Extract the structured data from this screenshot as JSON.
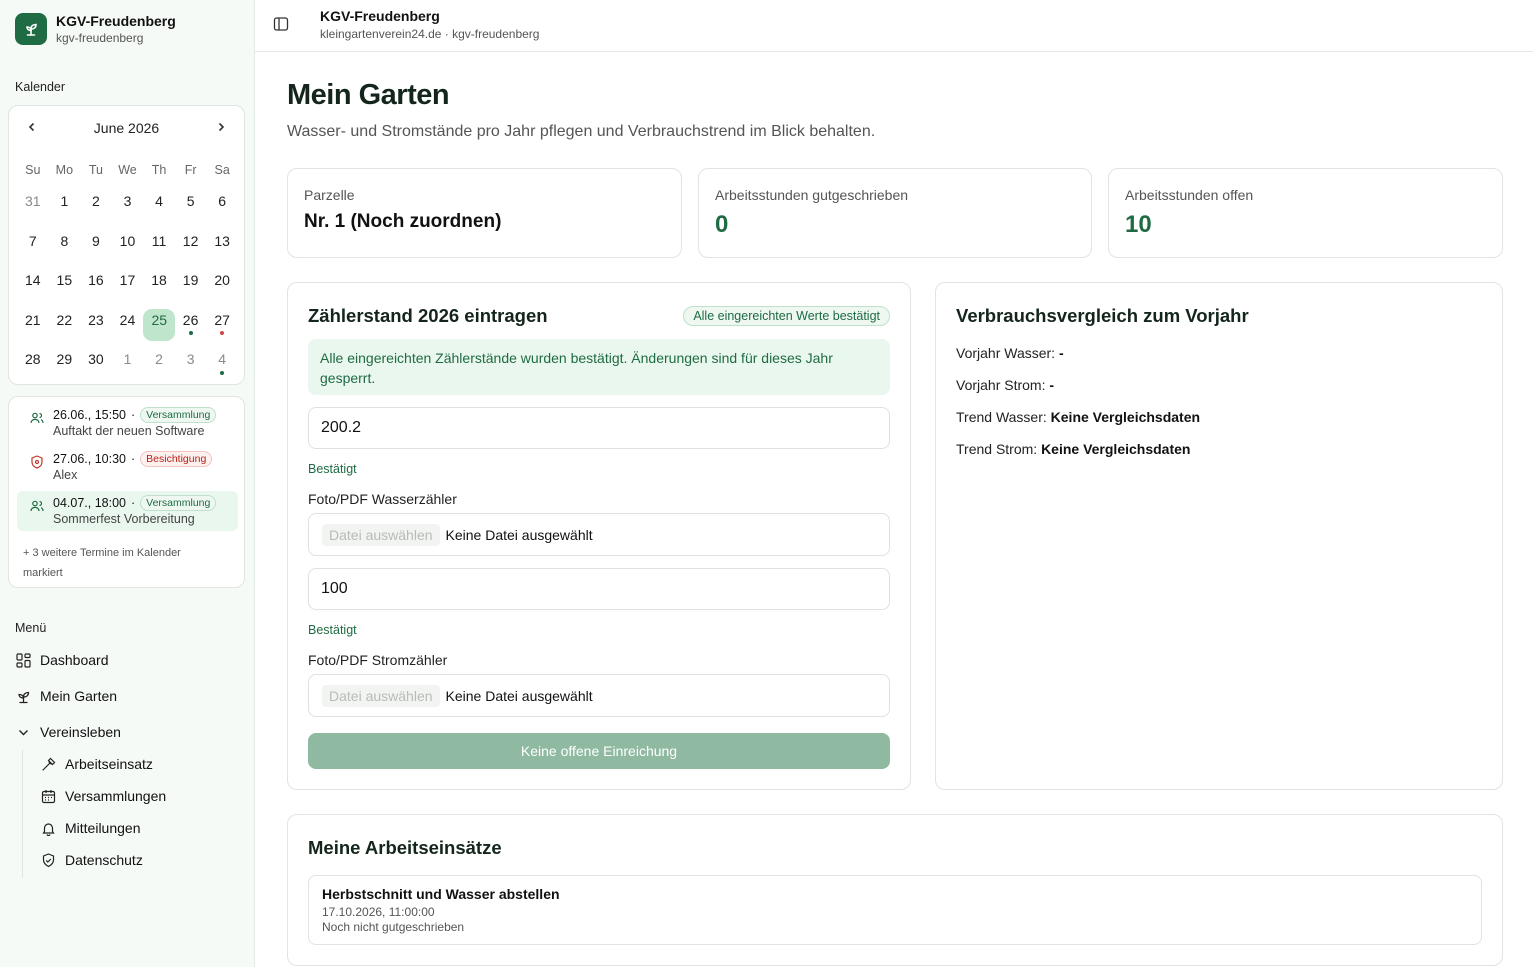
{
  "app": {
    "name": "KGV-Freudenberg",
    "slug": "kgv-freudenberg"
  },
  "topbar": {
    "title": "KGV-Freudenberg",
    "subtitle": "kleingartenverein24.de · kgv-freudenberg"
  },
  "sidebar": {
    "calendar_label": "Kalender",
    "calendar": {
      "month": "June 2026",
      "weekdays": [
        "Su",
        "Mo",
        "Tu",
        "We",
        "Th",
        "Fr",
        "Sa"
      ],
      "weeks": [
        [
          "31",
          "1",
          "2",
          "3",
          "4",
          "5",
          "6"
        ],
        [
          "7",
          "8",
          "9",
          "10",
          "11",
          "12",
          "13"
        ],
        [
          "14",
          "15",
          "16",
          "17",
          "18",
          "19",
          "20"
        ],
        [
          "21",
          "22",
          "23",
          "24",
          "25",
          "26",
          "27"
        ],
        [
          "28",
          "29",
          "30",
          "1",
          "2",
          "3",
          "4"
        ]
      ],
      "today": "25"
    },
    "events": [
      {
        "datetime": "26.06., 15:50",
        "type": "Versammlung",
        "title": "Auftakt der neuen Software"
      },
      {
        "datetime": "27.06., 10:30",
        "type": "Besichtigung",
        "title": "Alex"
      },
      {
        "datetime": "04.07., 18:00",
        "type": "Versammlung",
        "title": "Sommerfest Vorbereitung"
      }
    ],
    "more_events": "+ 3 weitere Termine im Kalender markiert",
    "menu_label": "Menü",
    "menu": {
      "dashboard": "Dashboard",
      "mein_garten": "Mein Garten",
      "vereinsleben": "Vereinsleben",
      "arbeitseinsatz": "Arbeitseinsatz",
      "versammlungen": "Versammlungen",
      "mitteilungen": "Mitteilungen",
      "datenschutz": "Datenschutz"
    }
  },
  "page": {
    "title": "Mein Garten",
    "lead": "Wasser- und Stromstände pro Jahr pflegen und Verbrauchstrend im Blick behalten."
  },
  "stats": {
    "parzelle_label": "Parzelle",
    "parzelle_value": "Nr. 1 (Noch zuordnen)",
    "credited_label": "Arbeitsstunden gutgeschrieben",
    "credited_value": "0",
    "open_label": "Arbeitsstunden offen",
    "open_value": "10"
  },
  "meter": {
    "title": "Zählerstand 2026 eintragen",
    "status_pill": "Alle eingereichten Werte bestätigt",
    "notice": "Alle eingereichten Zählerstände wurden bestätigt. Änderungen sind für dieses Jahr gesperrt.",
    "water_value": "200.2",
    "water_status": "Bestätigt",
    "water_file_label": "Foto/PDF Wasserzähler",
    "power_value": "100",
    "power_status": "Bestätigt",
    "power_file_label": "Foto/PDF Stromzähler",
    "file_button": "Datei auswählen",
    "file_none": "Keine Datei ausgewählt",
    "submit": "Keine offene Einreichung"
  },
  "comparison": {
    "title": "Verbrauchsvergleich zum Vorjahr",
    "rows": [
      {
        "label": "Vorjahr Wasser:",
        "value": "-"
      },
      {
        "label": "Vorjahr Strom:",
        "value": "-"
      },
      {
        "label": "Trend Wasser:",
        "value": "Keine Vergleichsdaten"
      },
      {
        "label": "Trend Strom:",
        "value": "Keine Vergleichsdaten"
      }
    ]
  },
  "jobs": {
    "title": "Meine Arbeitseinsätze",
    "items": [
      {
        "title": "Herbstschnitt und Wasser abstellen",
        "date": "17.10.2026, 11:00:00",
        "status": "Noch nicht gutgeschrieben"
      }
    ]
  },
  "colors": {
    "accent": "#1f6b43",
    "accent_light": "#eaf7ee",
    "danger": "#b42318"
  }
}
